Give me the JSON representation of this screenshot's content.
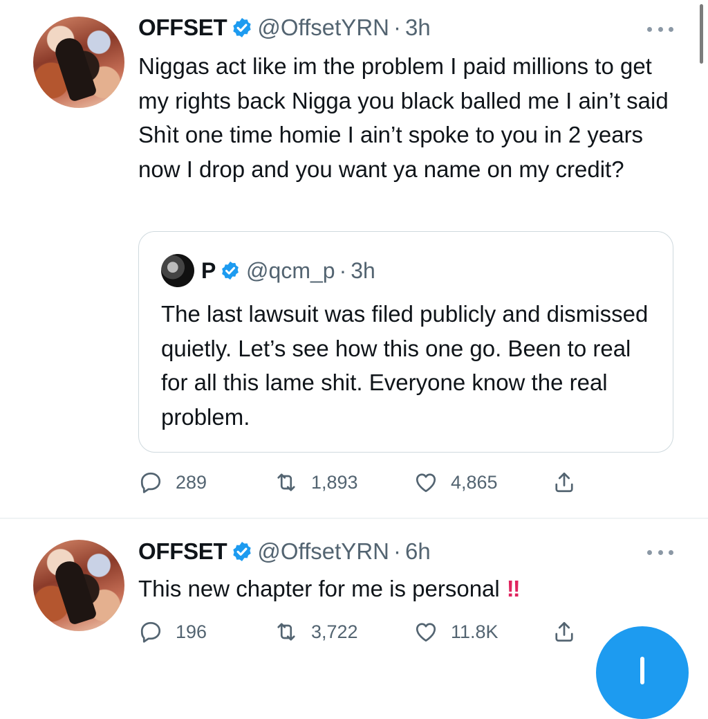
{
  "colors": {
    "accent": "#1d9bf0",
    "secondary_text": "#536471",
    "verified": "#1d9bf0",
    "alert": "#e0245e"
  },
  "tweets": [
    {
      "author": {
        "name": "OFFSET",
        "handle": "@OffsetYRN",
        "verified": true,
        "avatar_icon": "avatar"
      },
      "separator": "·",
      "time": "3h",
      "text": "Niggas act like im the problem I paid millions to get my rights back  Nigga you black balled me I ain’t said Shìt one time homie I ain’t spoke to you in 2 years now I drop and you want ya name on my credit?",
      "quote": {
        "author": {
          "name": "P",
          "handle": "@qcm_p",
          "verified": true
        },
        "separator": "·",
        "time": "3h",
        "text": "The last lawsuit was filed publicly and dismissed quietly. Let’s see how this one go. Been to real for all this lame shit. Everyone know the real problem."
      },
      "actions": {
        "replies": "289",
        "retweets": "1,893",
        "likes": "4,865",
        "share_icon": "share-icon"
      }
    },
    {
      "author": {
        "name": "OFFSET",
        "handle": "@OffsetYRN",
        "verified": true,
        "avatar_icon": "avatar"
      },
      "separator": "·",
      "time": "6h",
      "text": "This new chapter for me is personal",
      "emoji": "‼",
      "actions": {
        "replies": "196",
        "retweets": "3,722",
        "likes": "11.8K",
        "share_icon": "share-icon"
      }
    }
  ],
  "fab": {
    "icon": "compose-plus-icon"
  }
}
